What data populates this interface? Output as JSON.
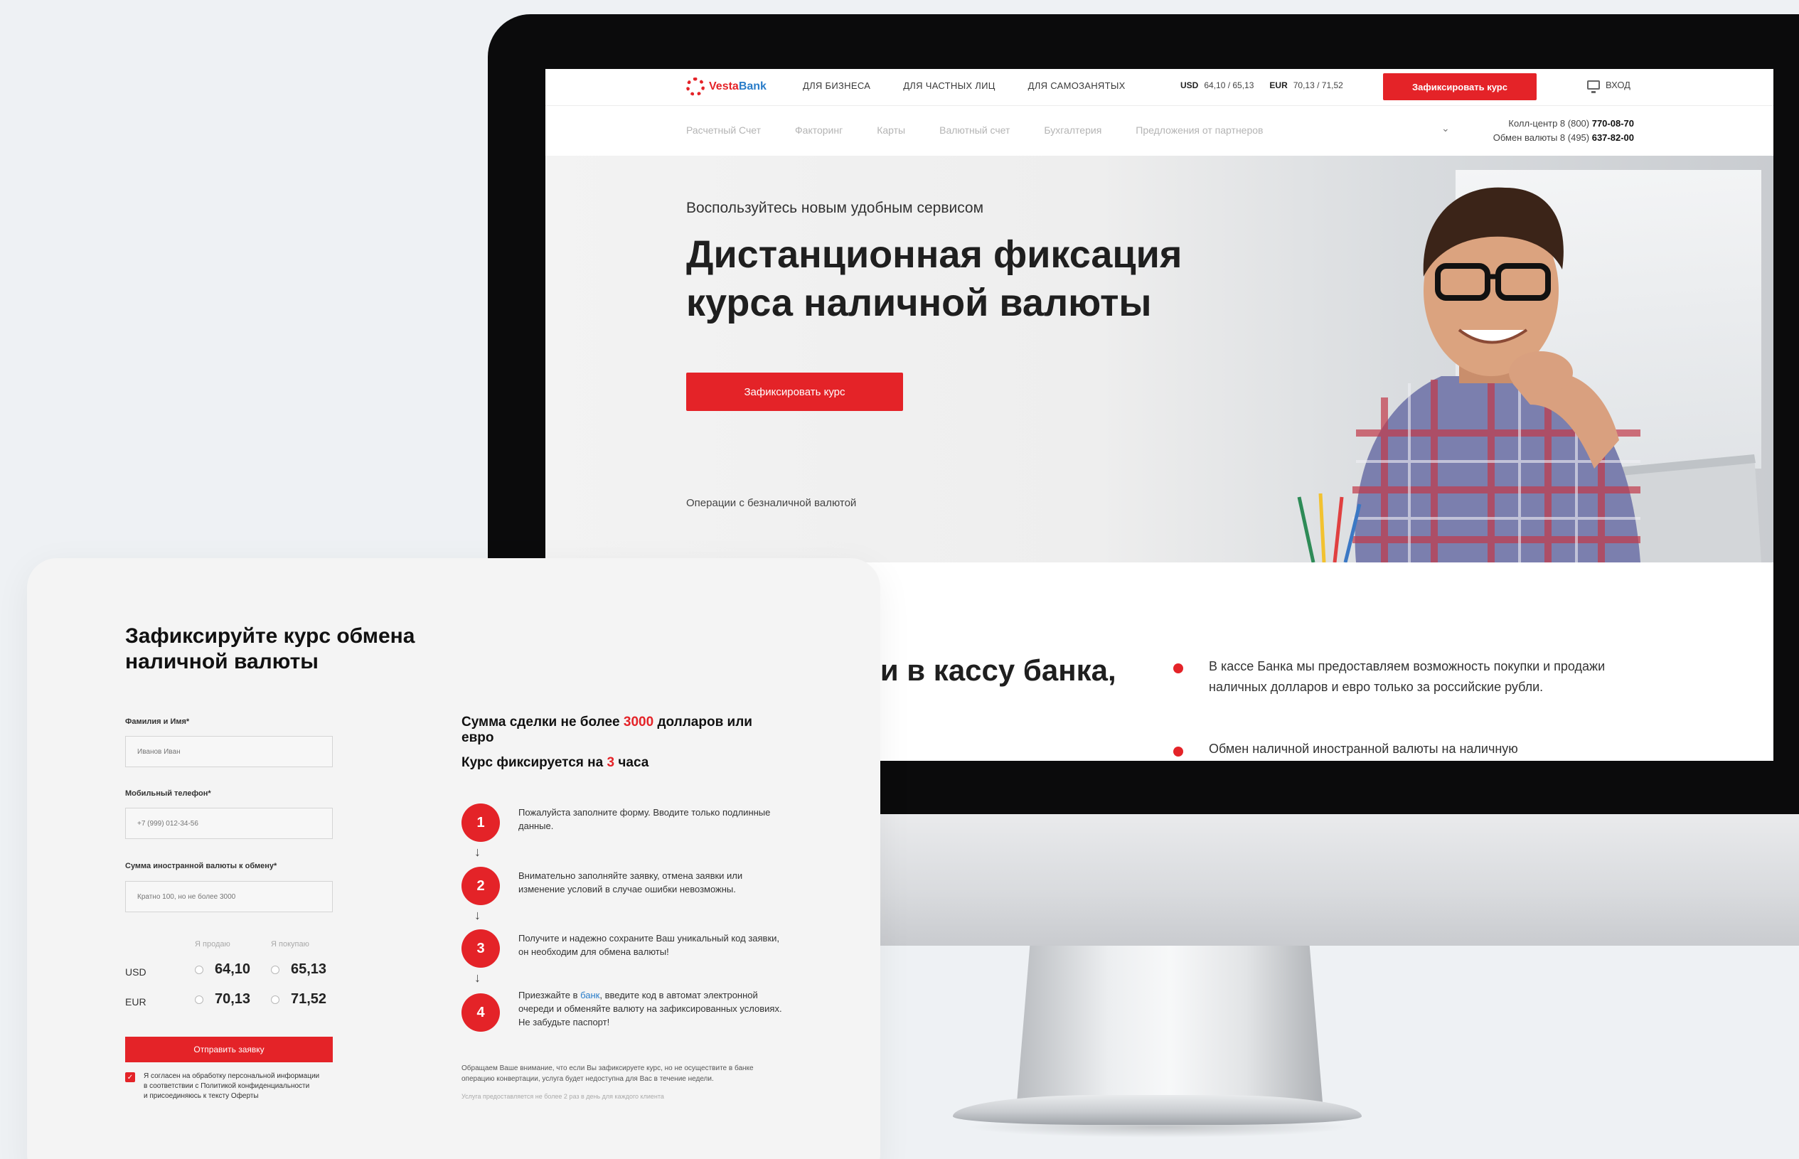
{
  "site": {
    "logo_text_a": "Vesta",
    "logo_text_b": "Bank",
    "top_nav": [
      "ДЛЯ БИЗНЕСА",
      "ДЛЯ ЧАСТНЫХ ЛИЦ",
      "ДЛЯ САМОЗАНЯТЫХ"
    ],
    "rates": {
      "usd_label": "USD",
      "usd_value": "64,10 / 65,13",
      "eur_label": "EUR",
      "eur_value": "70,13 / 71,52"
    },
    "fix_rate_button": "Зафиксировать курс",
    "login_label": "ВХОД",
    "sub_nav": [
      "Расчетный Счет",
      "Факторинг",
      "Карты",
      "Валютный счет",
      "Бухгалтерия",
      "Предложения от партнеров"
    ],
    "contacts": {
      "call_center_label": "Колл-центр 8 (800) ",
      "call_center_number": "770-08-70",
      "exchange_label": "Обмен валюты 8 (495) ",
      "exchange_number": "637-82-00"
    },
    "hero": {
      "subtitle": "Воспользуйтесь новым удобным сервисом",
      "title_line1": "Дистанционная фиксация",
      "title_line2": "курса наличной валюты",
      "button": "Зафиксировать курс",
      "link": "Операции с безналичной валютой"
    },
    "lower": {
      "title_fragment": "ии в кассу банка,",
      "bullets": [
        "В кассе Банка мы предоставляем возможность покупки и продажи наличных долларов и евро только за российские рубли.",
        "Обмен наличной иностранной валюты на наличную"
      ]
    }
  },
  "form": {
    "title": "Зафиксируйте курс обмена наличной валюты",
    "name_label": "Фамилия и Имя*",
    "name_placeholder": "Иванов Иван",
    "phone_label": "Мобильный телефон*",
    "phone_placeholder": "+7 (999) 012-34-56",
    "amount_label": "Сумма иностранной валюты к обмену*",
    "amount_placeholder": "Кратно 100, но не более 3000",
    "sell_header": "Я продаю",
    "buy_header": "Я покупаю",
    "rows": [
      {
        "currency": "USD",
        "sell": "64,10",
        "buy": "65,13"
      },
      {
        "currency": "EUR",
        "sell": "70,13",
        "buy": "71,52"
      }
    ],
    "submit": "Отправить заявку",
    "consent_checked": true,
    "consent_line1": "Я согласен на обработку персональной информации",
    "consent_line2": "в соответствии с Политикой конфиденциальности",
    "consent_line3": "и присоединяюсь к тексту Оферты"
  },
  "info": {
    "sum_prefix": "Сумма сделки не более ",
    "sum_value": "3000",
    "sum_suffix": " долларов или евро",
    "fix_prefix": "Курс фиксируется на ",
    "fix_value": "3",
    "fix_suffix": " часа",
    "steps": [
      {
        "num": "1",
        "text": "Пожалуйста заполните форму. Вводите только подлинные данные."
      },
      {
        "num": "2",
        "text": "Внимательно заполняйте заявку, отмена заявки или изменение условий в случае ошибки невозможны."
      },
      {
        "num": "3",
        "text": "Получите и надежно сохраните Ваш уникальный код заявки, он необходим для обмена валюты!"
      },
      {
        "num": "4",
        "text_before": "Приезжайте в ",
        "text_link": "банк",
        "text_after": ", введите код в автомат электронной очереди и обменяйте валюту на зафиксированных условиях. Не забудьте паспорт!"
      }
    ],
    "note": "Обращаем Ваше внимание, что если Вы зафиксируете курс, но не осуществите в банке операцию конвертации, услуга будет недоступна для Вас в течение недели.",
    "note2": "Услуга предоставляется не более 2 раз в день для каждого клиента"
  },
  "colors": {
    "accent": "#e42328",
    "link": "#2a7dc9"
  },
  "icons": [
    "logo-mark-icon",
    "monitor-icon",
    "chevron-down-icon",
    "arrow-down-icon",
    "checkbox-checked-icon"
  ]
}
